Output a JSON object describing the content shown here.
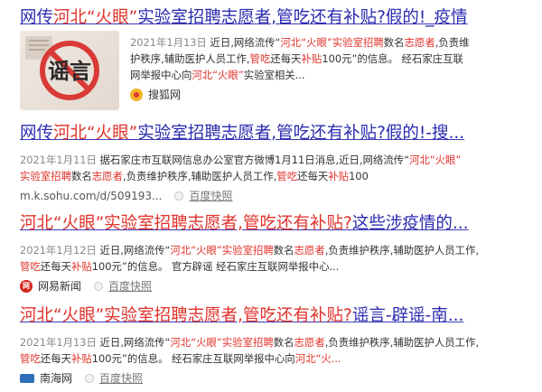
{
  "results": [
    {
      "title_parts": [
        {
          "t": "网传",
          "c": "bl"
        },
        {
          "t": "河北“火眼”",
          "c": "hl"
        },
        {
          "t": "实验室招聘志愿者,管吃还有补贴?假的!_疫情",
          "c": "bl"
        }
      ],
      "date": "2021年1月13日",
      "snippet_lines": [
        [
          {
            "t": "近日,网络流传“",
            "c": ""
          },
          {
            "t": "河北“火眼”",
            "c": "em"
          },
          {
            "t": "实验室招聘",
            "c": "em"
          },
          {
            "t": "数名",
            "c": ""
          },
          {
            "t": "志愿者",
            "c": "em"
          },
          {
            "t": ",负责维",
            "c": ""
          }
        ],
        [
          {
            "t": "护秩序,辅助医护人员工作,",
            "c": ""
          },
          {
            "t": "管吃",
            "c": "em"
          },
          {
            "t": "还每天",
            "c": ""
          },
          {
            "t": "补贴",
            "c": "em"
          },
          {
            "t": "100元”的信息。 经石家庄互联",
            "c": ""
          }
        ],
        [
          {
            "t": "网举报中心向",
            "c": ""
          },
          {
            "t": "河北“火眼”",
            "c": "em"
          },
          {
            "t": "实验室相关...",
            "c": ""
          }
        ]
      ],
      "source": "搜狐网",
      "thumb_text": "谣言"
    },
    {
      "title_parts": [
        {
          "t": "网传",
          "c": "bl"
        },
        {
          "t": "河北“火眼”",
          "c": "hl"
        },
        {
          "t": "实验室招聘志愿者,管吃还有补贴?假的!-搜...",
          "c": "bl"
        }
      ],
      "date": "2021年1月11日",
      "snippet_lines": [
        [
          {
            "t": "据石家庄市互联网信息办公室官方微博1月11日消息,近日,网络流传“",
            "c": ""
          },
          {
            "t": "河北“火眼”",
            "c": "em"
          }
        ],
        [
          {
            "t": "实验室招聘",
            "c": "em"
          },
          {
            "t": "数名",
            "c": ""
          },
          {
            "t": "志愿者",
            "c": "em"
          },
          {
            "t": ",负责维护秩序,辅助医护人员工作,",
            "c": ""
          },
          {
            "t": "管吃",
            "c": "em"
          },
          {
            "t": "还每天",
            "c": ""
          },
          {
            "t": "补贴",
            "c": "em"
          },
          {
            "t": "100",
            "c": ""
          }
        ]
      ],
      "url": "m.k.sohu.com/d/509193...",
      "kuaizhao": "百度快照"
    },
    {
      "title_parts": [
        {
          "t": "河北“火眼”",
          "c": "hl"
        },
        {
          "t": "实验室招聘志愿者,管吃还有补贴?",
          "c": "hl"
        },
        {
          "t": "这些涉疫情的...",
          "c": "bl"
        }
      ],
      "date": "2021年1月12日",
      "snippet_lines": [
        [
          {
            "t": "近日,网络流传“",
            "c": ""
          },
          {
            "t": "河北“火眼”",
            "c": "em"
          },
          {
            "t": "实验室招聘",
            "c": "em"
          },
          {
            "t": "数名",
            "c": ""
          },
          {
            "t": "志愿者",
            "c": "em"
          },
          {
            "t": ",负责维护秩序,辅助医护人员工作,",
            "c": ""
          }
        ],
        [
          {
            "t": "管吃",
            "c": "em"
          },
          {
            "t": "还每天",
            "c": ""
          },
          {
            "t": "补贴",
            "c": "em"
          },
          {
            "t": "100元”的信息。 官方辟谣 经石家庄互联网举报中心...",
            "c": ""
          }
        ]
      ],
      "source": "网易新闻",
      "kuaizhao": "百度快照"
    },
    {
      "title_parts": [
        {
          "t": "河北“火眼”",
          "c": "hl"
        },
        {
          "t": "实验室招聘志愿者,管吃还有补贴?",
          "c": "hl"
        },
        {
          "t": "谣言-辟谣-南...",
          "c": "bl"
        }
      ],
      "date": "2021年1月13日",
      "snippet_lines": [
        [
          {
            "t": "近日,网络流传“",
            "c": ""
          },
          {
            "t": "河北“火眼”",
            "c": "em"
          },
          {
            "t": "实验室招聘",
            "c": "em"
          },
          {
            "t": "数名",
            "c": ""
          },
          {
            "t": "志愿者",
            "c": "em"
          },
          {
            "t": ",负责维护秩序,辅助医护人员工作,",
            "c": ""
          }
        ],
        [
          {
            "t": "管吃",
            "c": "em"
          },
          {
            "t": "还每天",
            "c": ""
          },
          {
            "t": "补贴",
            "c": "em"
          },
          {
            "t": "100元”的信息。 经石家庄互联网举报中心向",
            "c": ""
          },
          {
            "t": "河北“火...",
            "c": "em"
          }
        ]
      ],
      "source": "南海网",
      "kuaizhao": "百度快照"
    }
  ],
  "colors": {
    "highlight": "#e0322b",
    "link": "#2b2bb0"
  },
  "icons": {
    "kuaizhao": "circle-icon",
    "sohu": "sohu-favicon-icon",
    "netease": "netease-favicon-icon",
    "nanhai": "nanhai-favicon-icon"
  }
}
